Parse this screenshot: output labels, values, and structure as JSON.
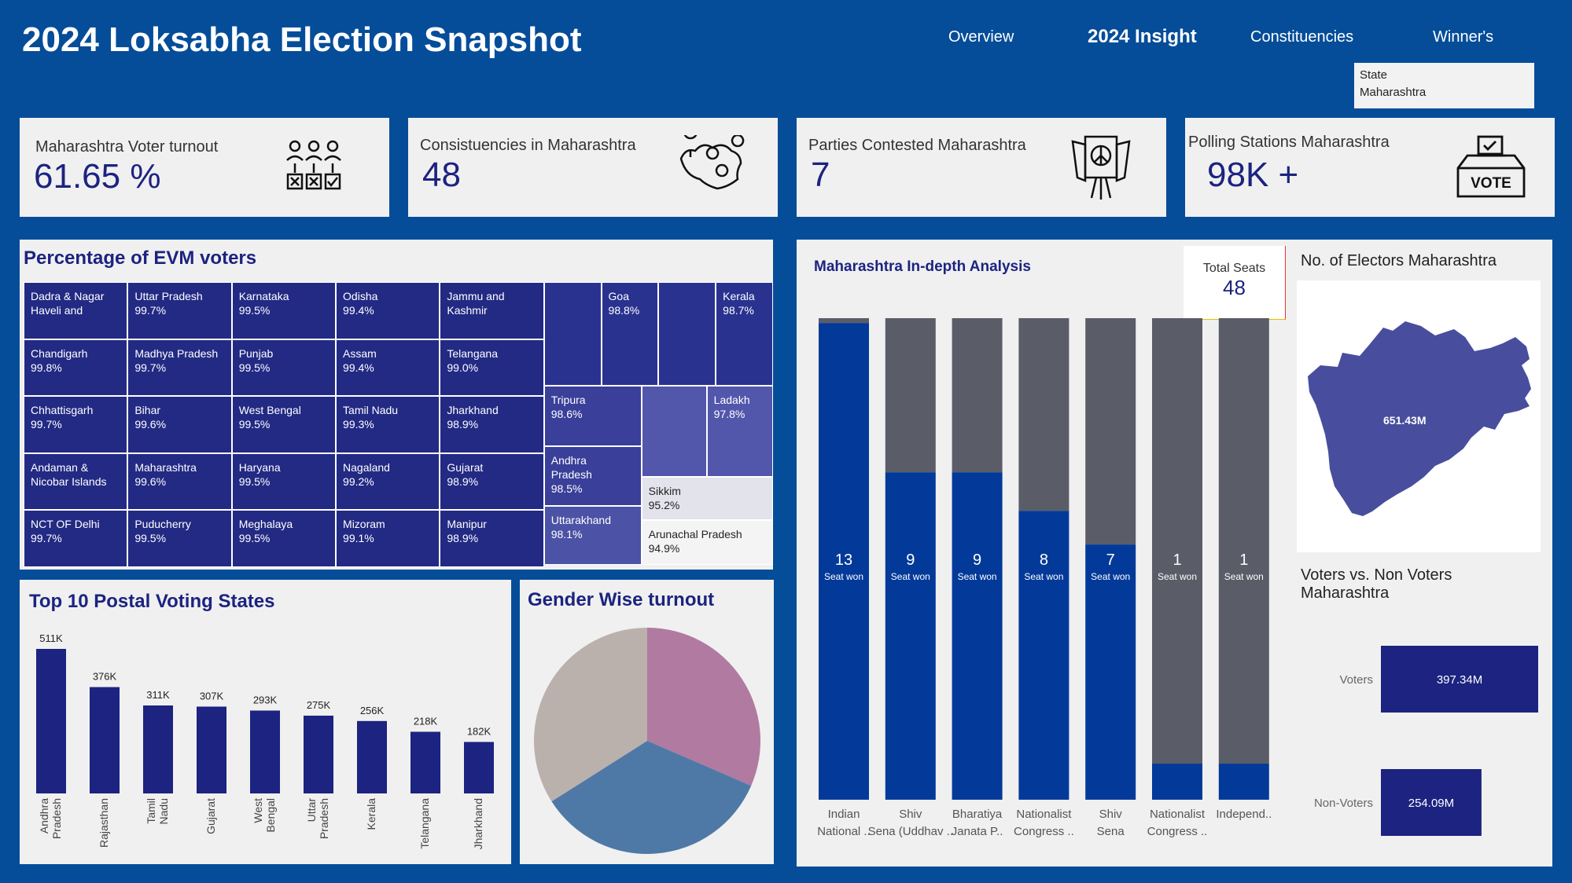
{
  "header": {
    "title": "2024 Loksabha Election Snapshot",
    "nav": [
      "Overview",
      "2024 Insight",
      "Constituencies",
      "Winner's"
    ],
    "active_nav": "2024 Insight"
  },
  "state_filter": {
    "label": "State",
    "value": "Maharashtra"
  },
  "kpis": [
    {
      "label": "Maharashtra Voter turnout",
      "value": "61.65 %",
      "icon": "voters-ballot-icon"
    },
    {
      "label": "Consistuencies in Maharashtra",
      "value": "48",
      "icon": "map-pins-icon"
    },
    {
      "label": "Parties Contested Maharashtra",
      "value": "7",
      "icon": "election-sign-icon"
    },
    {
      "label": "Polling Stations Maharashtra",
      "value": "98K +",
      "icon": "vote-box-icon"
    }
  ],
  "evm": {
    "title": "Percentage of EVM voters",
    "cells": [
      {
        "name": "Dadra & Nagar\nHaveli and",
        "value": ""
      },
      {
        "name": "Uttar Pradesh",
        "value": "99.7%"
      },
      {
        "name": "Karnataka",
        "value": "99.5%"
      },
      {
        "name": "Odisha",
        "value": "99.4%"
      },
      {
        "name": "Jammu and\nKashmir",
        "value": ""
      },
      {
        "name": "Chandigarh",
        "value": "99.8%"
      },
      {
        "name": "Madhya Pradesh",
        "value": "99.7%"
      },
      {
        "name": "Punjab",
        "value": "99.5%"
      },
      {
        "name": "Assam",
        "value": "99.4%"
      },
      {
        "name": "Telangana",
        "value": "99.0%"
      },
      {
        "name": "Chhattisgarh",
        "value": "99.7%"
      },
      {
        "name": "Bihar",
        "value": "99.6%"
      },
      {
        "name": "West Bengal",
        "value": "99.5%"
      },
      {
        "name": "Tamil Nadu",
        "value": "99.3%"
      },
      {
        "name": "Jharkhand",
        "value": "98.9%"
      },
      {
        "name": "Andaman &\nNicobar Islands",
        "value": ""
      },
      {
        "name": "Maharashtra",
        "value": "99.6%"
      },
      {
        "name": "Haryana",
        "value": "99.5%"
      },
      {
        "name": "Nagaland",
        "value": "99.2%"
      },
      {
        "name": "Gujarat",
        "value": "98.9%"
      },
      {
        "name": "NCT OF Delhi",
        "value": "99.7%"
      },
      {
        "name": "Puducherry",
        "value": "99.5%"
      },
      {
        "name": "Meghalaya",
        "value": "99.5%"
      },
      {
        "name": "Mizoram",
        "value": "99.1%"
      },
      {
        "name": "Manipur",
        "value": "98.9%"
      },
      {
        "name": "",
        "value": ""
      },
      {
        "name": "Goa",
        "value": "98.8%"
      },
      {
        "name": "",
        "value": ""
      },
      {
        "name": "Kerala",
        "value": "98.7%"
      },
      {
        "name": "Tripura",
        "value": "98.6%"
      },
      {
        "name": "",
        "value": ""
      },
      {
        "name": "Ladakh",
        "value": "97.8%"
      },
      {
        "name": "Andhra\nPradesh",
        "value": "98.5%"
      },
      {
        "name": "Sikkim",
        "value": "95.2%"
      },
      {
        "name": "Uttarakhand",
        "value": "98.1%"
      },
      {
        "name": "Arunachal Pradesh",
        "value": "94.9%"
      }
    ]
  },
  "postal": {
    "title": "Top 10 Postal Voting States"
  },
  "gender": {
    "title": "Gender Wise turnout"
  },
  "analysis": {
    "title": "Maharashtra In-depth Analysis",
    "total_seats_label": "Total Seats",
    "total_seats_value": "48",
    "seat_won_label": "Seat won"
  },
  "electors": {
    "title": "No. of Electors Maharashtra",
    "value": "651.43M"
  },
  "voters_vs": {
    "title": "Voters vs. Non Voters\nMaharashtra"
  },
  "chart_data": [
    {
      "type": "bar",
      "title": "Top 10 Postal Voting States",
      "categories": [
        "Andhra Pradesh",
        "Rajasthan",
        "Tamil Nadu",
        "Gujarat",
        "West Bengal",
        "Uttar Pradesh",
        "Kerala",
        "Telangana",
        "Jharkhand"
      ],
      "values": [
        511,
        376,
        311,
        307,
        293,
        275,
        256,
        218,
        182
      ],
      "labels": [
        "511K",
        "376K",
        "311K",
        "307K",
        "293K",
        "275K",
        "256K",
        "218K",
        "182K"
      ],
      "colors": {
        "bar": "#1c2380"
      }
    },
    {
      "type": "pie",
      "title": "Gender Wise turnout",
      "slices": [
        {
          "value": 31.5,
          "color": "#b07aa1"
        },
        {
          "value": 34.5,
          "color": "#4e79a7"
        },
        {
          "value": 34.0,
          "color": "#bab0ac"
        }
      ]
    },
    {
      "type": "bar",
      "title": "Maharashtra In-depth Analysis",
      "categories": [
        "Indian National ..",
        "Shiv Sena (Uddhav ..",
        "Bharatiya Janata P..",
        "Nationalist Congress ..",
        "Shiv Sena",
        "Nationalist Congress ..",
        "Independ.."
      ],
      "values": [
        13,
        9,
        9,
        8,
        7,
        1,
        1
      ],
      "won_share": [
        0.99,
        0.68,
        0.68,
        0.6,
        0.53,
        0.075,
        0.075
      ],
      "colors": {
        "won": "#033a99",
        "lost": "#5a5d68"
      }
    },
    {
      "type": "bar",
      "title": "Voters vs. Non Voters Maharashtra",
      "categories": [
        "Voters",
        "Non-Voters"
      ],
      "values": [
        397.34,
        254.09
      ],
      "labels": [
        "397.34M",
        "254.09M"
      ],
      "unit": "M",
      "colors": {
        "bar": "#1c2380"
      }
    }
  ]
}
